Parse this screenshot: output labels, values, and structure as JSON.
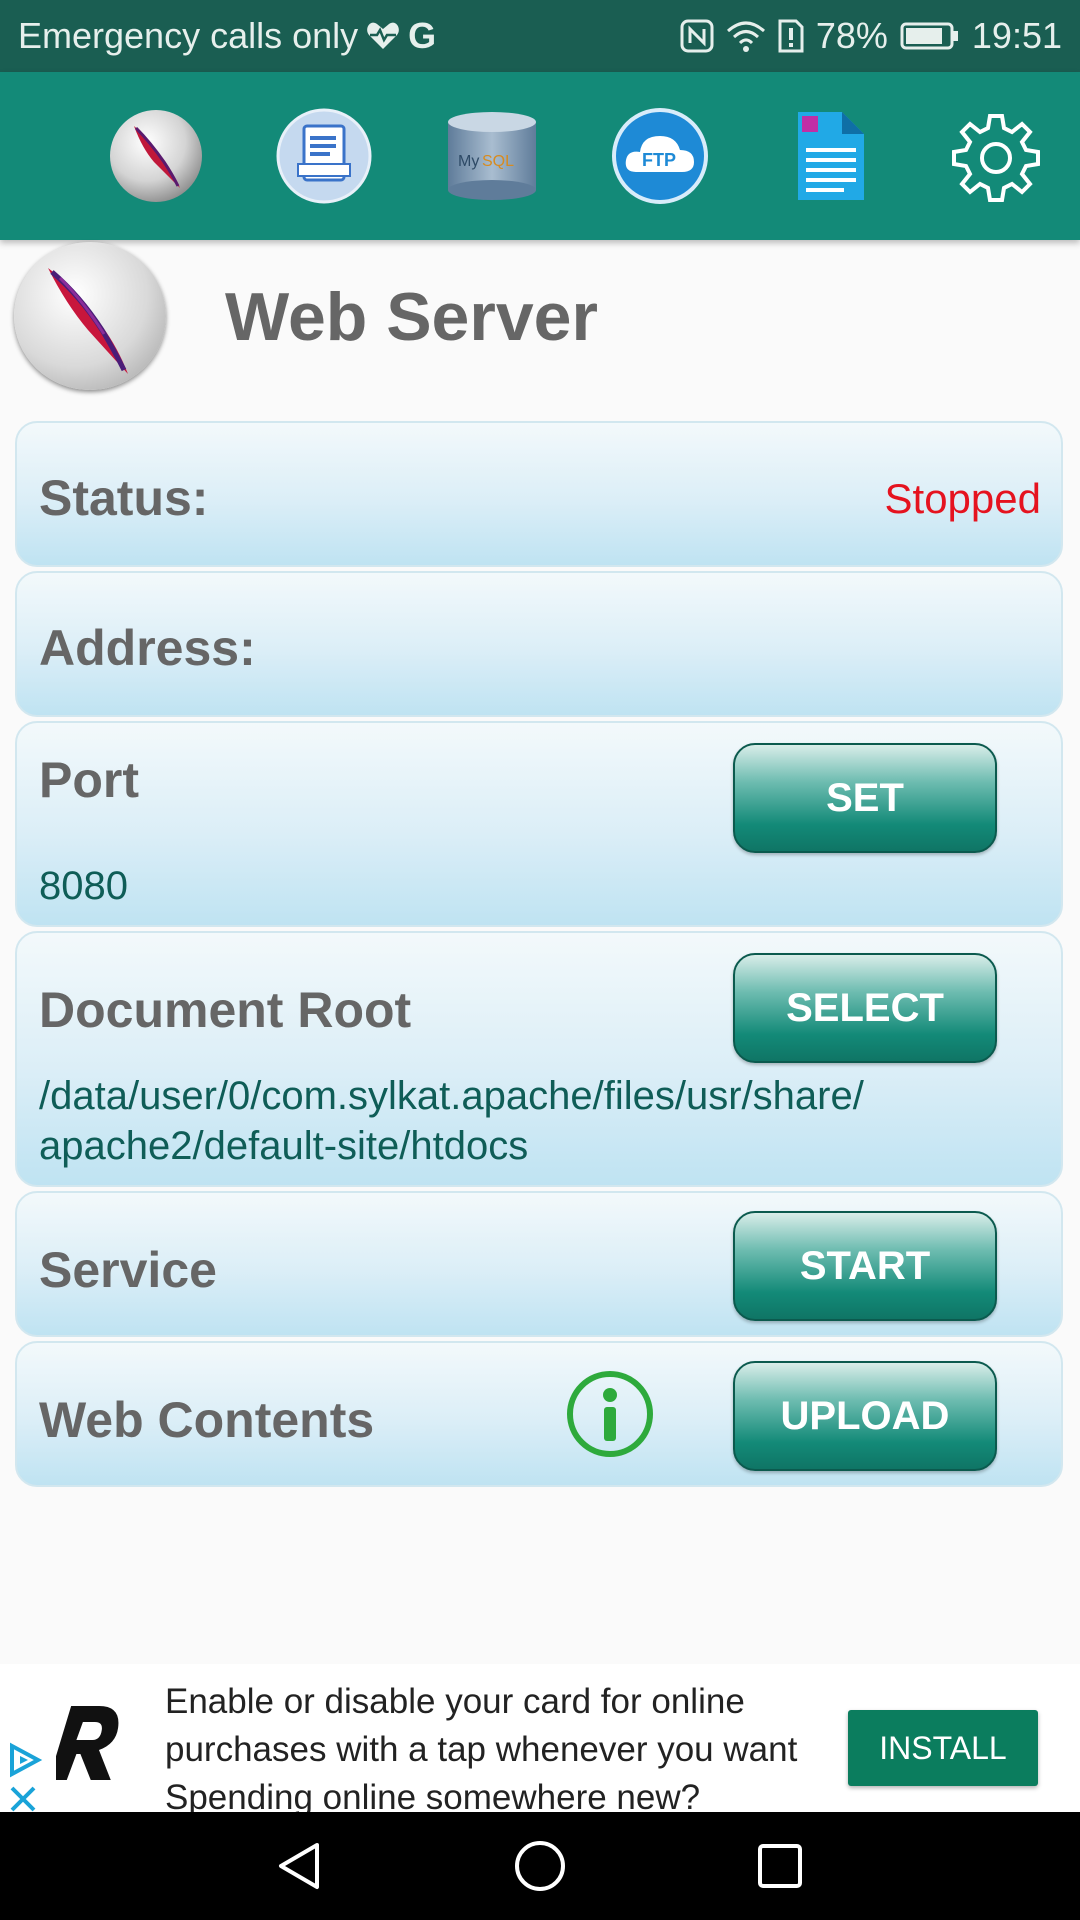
{
  "status_bar": {
    "carrier": "Emergency calls only",
    "network_type": "G",
    "battery": "78%",
    "time": "19:51"
  },
  "toolbar": {
    "items": [
      {
        "name": "apache",
        "icon": "feather-icon"
      },
      {
        "name": "logs",
        "icon": "document-icon"
      },
      {
        "name": "mysql",
        "icon": "database-icon"
      },
      {
        "name": "ftp",
        "icon": "cloud-ftp-icon",
        "label": "FTP"
      },
      {
        "name": "editor",
        "icon": "file-icon"
      },
      {
        "name": "settings",
        "icon": "gear-icon"
      }
    ]
  },
  "header": {
    "title": "Web Server"
  },
  "status": {
    "label": "Status:",
    "value": "Stopped",
    "value_color": "#e5131f"
  },
  "address": {
    "label": "Address:",
    "value": ""
  },
  "port": {
    "label": "Port",
    "value": "8080",
    "button": "SET"
  },
  "document_root": {
    "label": "Document Root",
    "value_line1": "/data/user/0/com.sylkat.apache/files/usr/share/",
    "value_line2": "apache2/default-site/htdocs",
    "button": "SELECT"
  },
  "service": {
    "label": "Service",
    "button": "START"
  },
  "web_contents": {
    "label": "Web Contents",
    "button": "UPLOAD"
  },
  "ad": {
    "line1": "Enable or disable your card for online",
    "line2": "purchases with a tap whenever you want",
    "line3": "Spending online somewhere new?",
    "button": "INSTALL"
  },
  "colors": {
    "accent": "#138a78",
    "status_bar": "#1a5e52",
    "install": "#0b7d5e",
    "stopped": "#e5131f"
  }
}
